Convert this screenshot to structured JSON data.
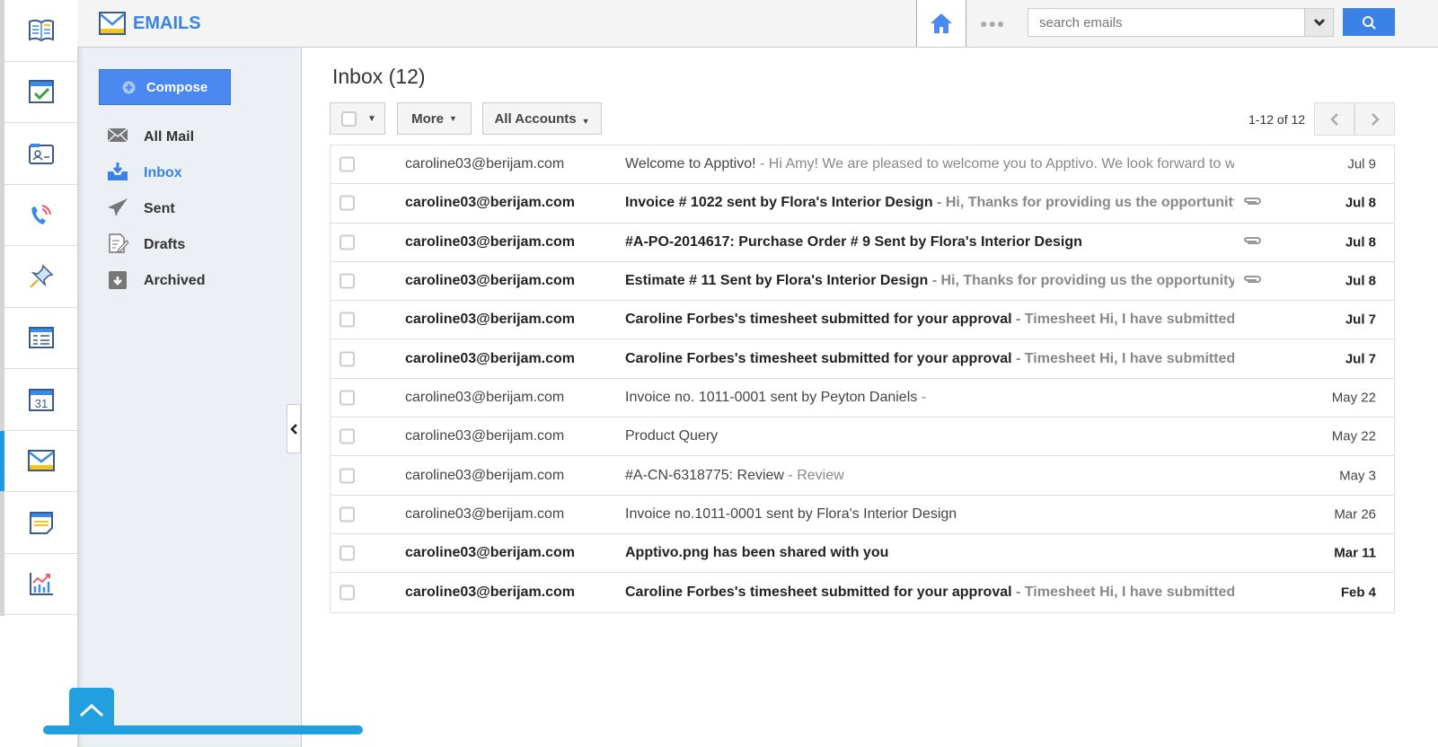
{
  "app": {
    "title": "EMAILS"
  },
  "rail": [
    {
      "name": "knowledge-base-icon",
      "active": false
    },
    {
      "name": "tasks-icon",
      "active": false
    },
    {
      "name": "contacts-icon",
      "active": false
    },
    {
      "name": "calls-icon",
      "active": false
    },
    {
      "name": "pin-icon",
      "active": false
    },
    {
      "name": "forms-icon",
      "active": false
    },
    {
      "name": "calendar-icon",
      "active": false,
      "label": "31"
    },
    {
      "name": "email-icon",
      "active": true
    },
    {
      "name": "notes-icon",
      "active": false
    },
    {
      "name": "reports-icon",
      "active": false
    }
  ],
  "search": {
    "placeholder": "search emails"
  },
  "sidebar": {
    "compose": "Compose",
    "items": [
      {
        "label": "All Mail",
        "icon": "envelope-icon",
        "active": false
      },
      {
        "label": "Inbox",
        "icon": "inbox-icon",
        "active": true
      },
      {
        "label": "Sent",
        "icon": "paper-plane-icon",
        "active": false
      },
      {
        "label": "Drafts",
        "icon": "drafts-icon",
        "active": false
      },
      {
        "label": "Archived",
        "icon": "archive-icon",
        "active": false
      }
    ]
  },
  "main": {
    "title": "Inbox (12)",
    "more": "More",
    "accounts": "All Accounts",
    "pager": "1-12 of 12"
  },
  "emails": [
    {
      "from": "caroline03@berijam.com",
      "subject": "Welcome to Apptivo!",
      "preview": " - Hi Amy! We are pleased to welcome you to Apptivo. We look forward to w",
      "date": "Jul 9",
      "unread": false,
      "attachment": false
    },
    {
      "from": "caroline03@berijam.com",
      "subject": "Invoice # 1022 sent by Flora's Interior Design",
      "preview": " - Hi,  Thanks for providing us the opportunity",
      "date": "Jul 8",
      "unread": true,
      "attachment": true
    },
    {
      "from": "caroline03@berijam.com",
      "subject": "#A-PO-2014617: Purchase Order # 9 Sent by Flora's Interior Design",
      "preview": "",
      "date": "Jul 8",
      "unread": true,
      "attachment": true
    },
    {
      "from": "caroline03@berijam.com",
      "subject": "Estimate # 11 Sent by Flora's Interior Design",
      "preview": " - Hi,  Thanks for providing us the opportunity",
      "date": "Jul 8",
      "unread": true,
      "attachment": true
    },
    {
      "from": "caroline03@berijam.com",
      "subject": "Caroline Forbes's timesheet submitted for your approval",
      "preview": " - Timesheet Hi, I have submitted",
      "date": "Jul 7",
      "unread": true,
      "attachment": false
    },
    {
      "from": "caroline03@berijam.com",
      "subject": "Caroline Forbes's timesheet submitted for your approval",
      "preview": " - Timesheet Hi, I have submitted",
      "date": "Jul 7",
      "unread": true,
      "attachment": false
    },
    {
      "from": "caroline03@berijam.com",
      "subject": "Invoice no. 1011-0001 sent by Peyton Daniels",
      "preview": " -",
      "date": "May 22",
      "unread": false,
      "attachment": false
    },
    {
      "from": "caroline03@berijam.com",
      "subject": "Product Query",
      "preview": "",
      "date": "May 22",
      "unread": false,
      "attachment": false
    },
    {
      "from": "caroline03@berijam.com",
      "subject": "#A-CN-6318775: Review",
      "preview": " - Review",
      "date": "May 3",
      "unread": false,
      "attachment": false
    },
    {
      "from": "caroline03@berijam.com",
      "subject": "Invoice no.1011-0001 sent by Flora's Interior Design",
      "preview": "",
      "date": "Mar 26",
      "unread": false,
      "attachment": false
    },
    {
      "from": "caroline03@berijam.com",
      "subject": "Apptivo.png has been shared with you",
      "preview": "",
      "date": "Mar 11",
      "unread": true,
      "attachment": false
    },
    {
      "from": "caroline03@berijam.com",
      "subject": "Caroline Forbes's timesheet submitted for your approval",
      "preview": " - Timesheet Hi, I have submitted",
      "date": "Feb 4",
      "unread": true,
      "attachment": false
    }
  ]
}
